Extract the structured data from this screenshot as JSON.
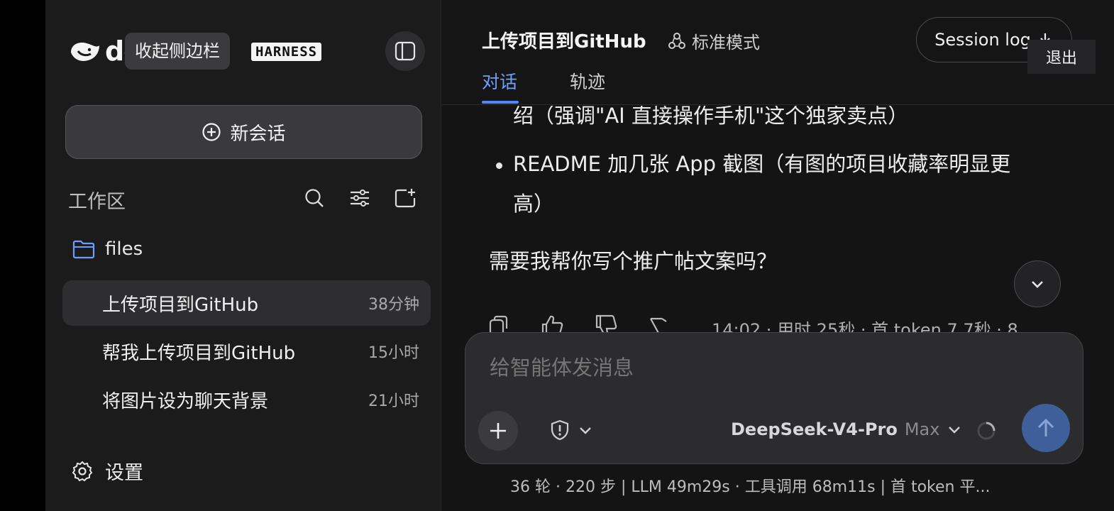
{
  "sidebar": {
    "brand_word": "de",
    "brand_tag": "HARNESS",
    "tooltip": "收起侧边栏",
    "new_chat_label": "新会话",
    "workspace_label": "工作区",
    "folder_name": "files",
    "conversations": [
      {
        "title": "上传项目到GitHub",
        "time": "38分钟"
      },
      {
        "title": "帮我上传项目到GitHub",
        "time": "15小时"
      },
      {
        "title": "将图片设为聊天背景",
        "time": "21小时"
      }
    ],
    "settings_label": "设置"
  },
  "header": {
    "title": "上传项目到GitHub",
    "mode": "标准模式",
    "session_log": "Session log",
    "exit_tooltip": "退出",
    "tabs": [
      "对话",
      "轨迹"
    ]
  },
  "messages": {
    "bullet1_line": "绍（强调\"AI 直接操作手机\"这个独家卖点）",
    "bullet2_line1": "README 加几张 App 截图（有图的项目收藏率明显更",
    "bullet2_line2": "高）",
    "question": "需要我帮你写个推广帖文案吗？",
    "meta": "14:02  ·  用时 25秒  ·  首 token 7.7秒  ·  8"
  },
  "composer": {
    "placeholder": "给智能体发消息",
    "model_name": "DeepSeek-V4-Pro",
    "model_tier": "Max"
  },
  "footer": {
    "stats": "36 轮 · 220 步   |   LLM 49m29s · 工具调用 68m11s   |   首 token 平..."
  },
  "colors": {
    "accent": "#4e86ff",
    "send_button": "#3e5f9a",
    "sidebar_bg": "#1b1b1c",
    "main_bg": "#141414"
  }
}
